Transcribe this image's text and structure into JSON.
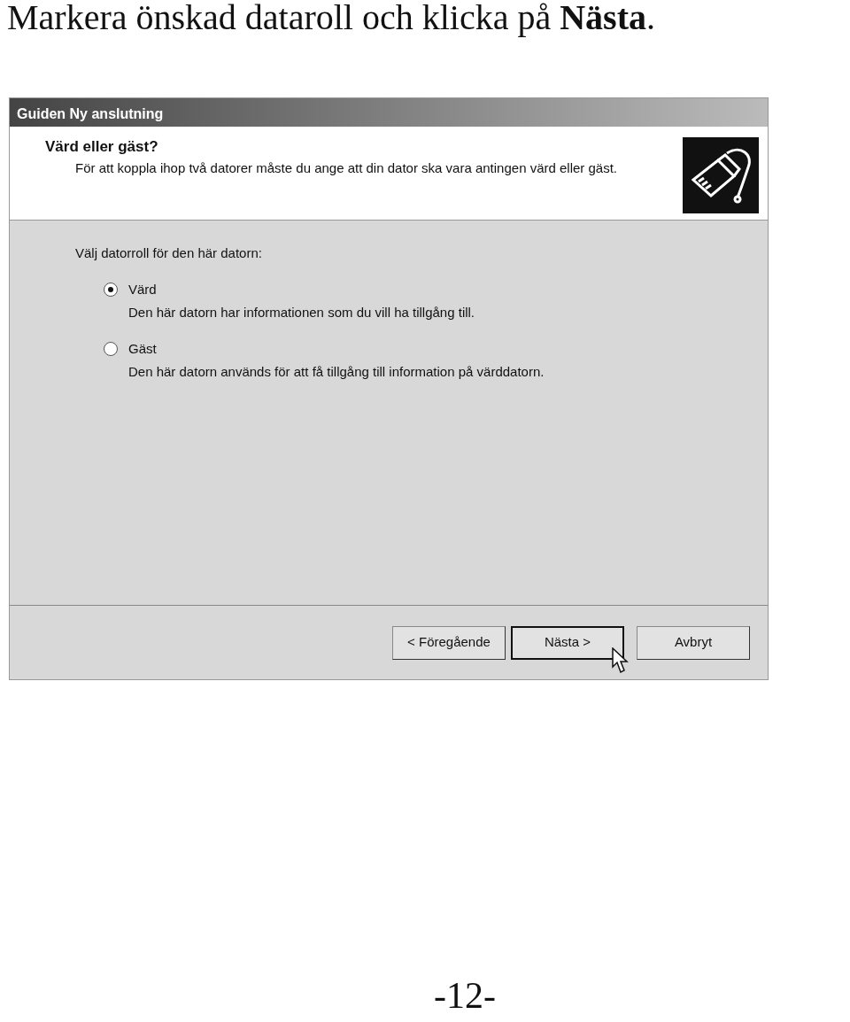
{
  "heading": "Markera önskad dataroll och klicka på **Nästa**.",
  "window": {
    "title": "Guiden Ny anslutning",
    "header_title": "Värd eller gäst?",
    "header_text": "För att koppla ihop två datorer måste du ange att din dator ska vara antingen värd eller gäst.",
    "prompt": "Välj datorroll för den här datorn:",
    "options": [
      {
        "label": "Värd",
        "description": "Den här datorn har informationen som du vill ha tillgång till.",
        "selected": true
      },
      {
        "label": "Gäst",
        "description": "Den här datorn används för att få tillgång till information på värddatorn.",
        "selected": false
      }
    ],
    "buttons": [
      {
        "label": "< Föregående",
        "default": false
      },
      {
        "label": "Nästa >",
        "default": true
      },
      {
        "label": "Avbryt",
        "default": false
      }
    ]
  },
  "page_number": "-12-"
}
